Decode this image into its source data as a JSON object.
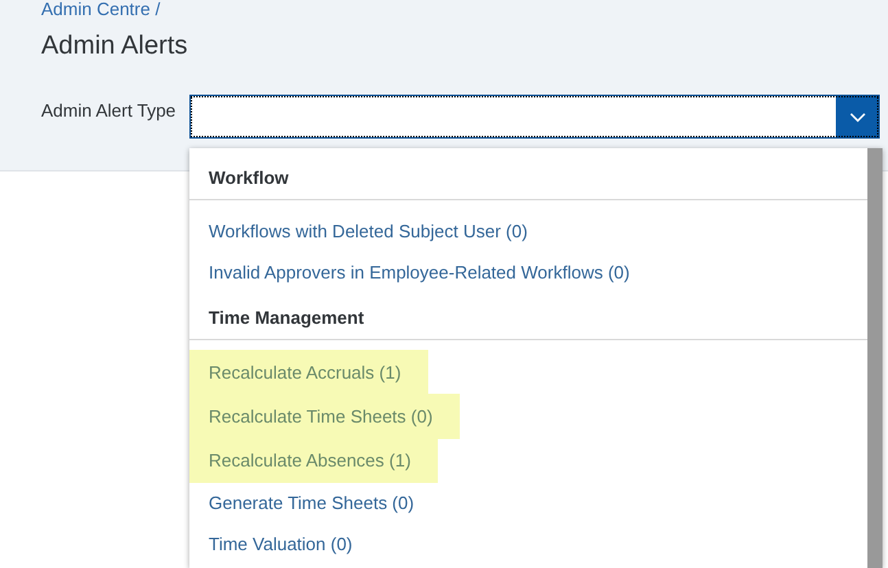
{
  "breadcrumb": "Admin Centre /",
  "title": "Admin Alerts",
  "field": {
    "label": "Admin Alert Type"
  },
  "dropdown": {
    "groups": [
      {
        "heading": "Workflow",
        "items": [
          {
            "label": "Workflows with Deleted Subject User (0)",
            "highlighted": false
          },
          {
            "label": "Invalid Approvers in Employee-Related Workflows (0)",
            "highlighted": false
          }
        ]
      },
      {
        "heading": "Time Management",
        "items": [
          {
            "label": "Recalculate Accruals (1)",
            "highlighted": true
          },
          {
            "label": "Recalculate Time Sheets (0)",
            "highlighted": true
          },
          {
            "label": "Recalculate Absences (1)",
            "highlighted": true
          },
          {
            "label": "Generate Time Sheets (0)",
            "highlighted": false
          },
          {
            "label": "Time Valuation (0)",
            "highlighted": false
          }
        ]
      }
    ]
  }
}
